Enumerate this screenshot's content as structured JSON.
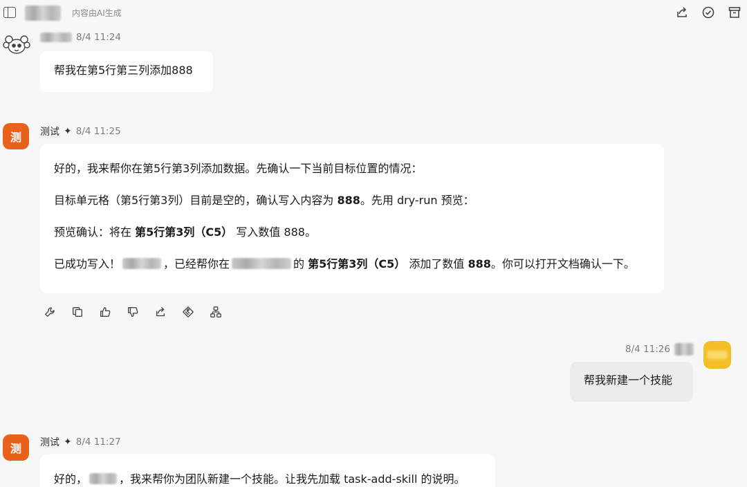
{
  "header": {
    "ai_notice": "内容由AI生成",
    "icons": [
      "sidebar-toggle-icon",
      "share-icon",
      "check-circle-icon",
      "archive-icon"
    ]
  },
  "messages": [
    {
      "role": "user",
      "time": "8/4 11:24",
      "text": "帮我在第5行第三列添加888"
    },
    {
      "role": "bot",
      "name": "测试",
      "avatar_char": "测",
      "time": "8/4 11:25",
      "paragraphs": {
        "p1": "好的，我来帮你在第5行第3列添加数据。先确认一下当前目标位置的情况：",
        "p2_a": "目标单元格（第5行第3列）目前是空的，确认写入内容为 ",
        "p2_b": "888",
        "p2_c": "。先用 dry-run 预览：",
        "p3_a": "预览确认：将在 ",
        "p3_b": "第5行第3列（C5）",
        "p3_c": " 写入数值 888。",
        "p4_a": "已成功写入！",
        "p4_b": "，已经帮你在",
        "p4_c": "的 ",
        "p4_d": "第5行第3列（C5）",
        "p4_e": " 添加了数值 ",
        "p4_f": "888",
        "p4_g": "。你可以打开文档确认一下。"
      },
      "actions": [
        "wrench-icon",
        "copy-icon",
        "thumbs-up-icon",
        "thumbs-down-icon",
        "share-icon",
        "tag-icon",
        "tree-icon"
      ]
    },
    {
      "role": "user",
      "time": "8/4 11:26",
      "text": "帮我新建一个技能"
    },
    {
      "role": "bot",
      "name": "测试",
      "avatar_char": "测",
      "time": "8/4 11:27",
      "text_a": "好的，",
      "text_b": "，我来帮你为团队新建一个技能。让我先加载 task-add-skill 的说明。"
    }
  ]
}
